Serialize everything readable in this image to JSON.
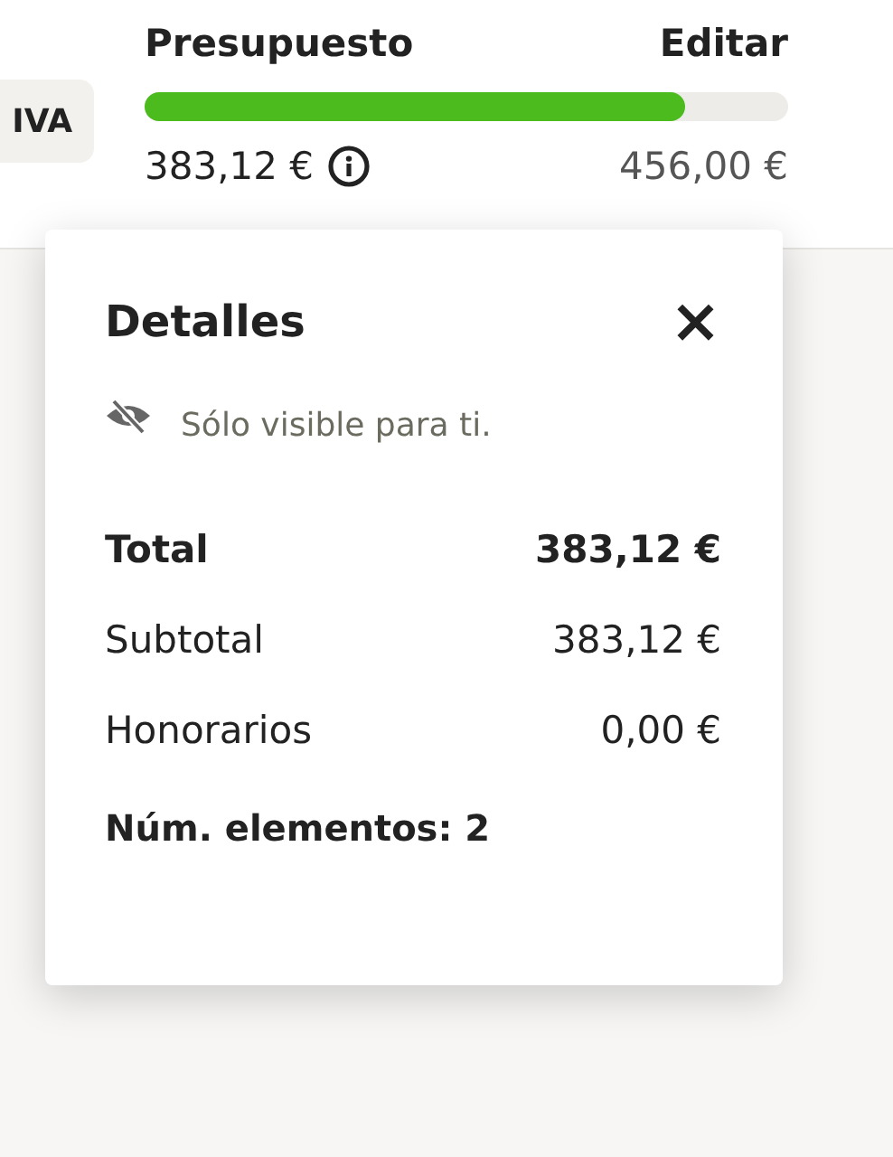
{
  "chip": {
    "label": "IVA"
  },
  "budget": {
    "title": "Presupuesto",
    "edit": "Editar",
    "level": 0.84,
    "spent": "383,12 €",
    "total": "456,00 €"
  },
  "popover": {
    "title": "Detalles",
    "close": "×",
    "note": "Sólo visible para ti.",
    "rows": [
      {
        "kind": "total",
        "label": "Total",
        "value": "383,12 €"
      },
      {
        "kind": "line",
        "label": "Subtotal",
        "value": "383,12 €"
      },
      {
        "kind": "line",
        "label": "Honorarios",
        "value": "0,00 €"
      }
    ],
    "count": "Núm. elementos: 2"
  }
}
